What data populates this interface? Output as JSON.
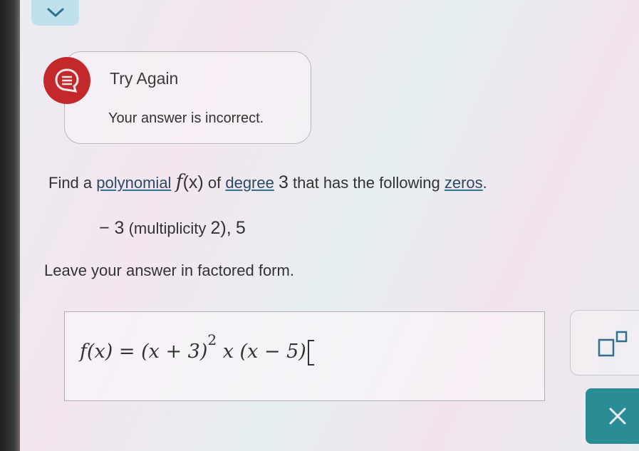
{
  "collapse_tab": {
    "icon": "chevron-down-icon"
  },
  "feedback": {
    "icon": "message-lines-icon",
    "title": "Try Again",
    "message": "Your answer is incorrect.",
    "badge_color": "#c3282a"
  },
  "question": {
    "prefix": "Find a",
    "term_polynomial": "polynomial",
    "function_name": "f",
    "function_arg": "(x)",
    "of_text": "of",
    "term_degree": "degree",
    "degree_value": "3",
    "middle_text": "that has the following",
    "term_zeros": "zeros",
    "period": "."
  },
  "zeros": {
    "zero1": "− 3",
    "multiplicity_label": "(multiplicity",
    "multiplicity_value": "2),",
    "zero2": "5"
  },
  "instruction": "Leave your answer in factored form.",
  "answer": {
    "lhs_f": "f",
    "lhs_arg": "(x)",
    "equals": "=",
    "factor1": "(x + 3)",
    "exponent": "2",
    "factor2": "x",
    "factor3": "(x − 5)"
  },
  "toolbar": {
    "superscript_icon": "superscript-template-icon",
    "clear_icon": "close-icon",
    "accent_color": "#2b8c96"
  }
}
